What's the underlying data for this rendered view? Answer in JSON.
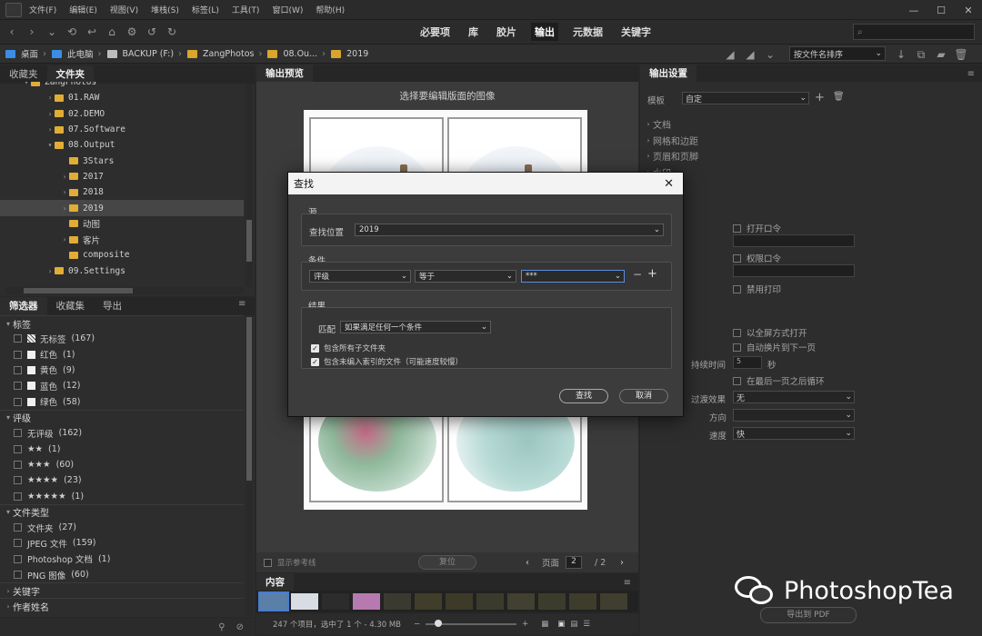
{
  "menu": [
    "文件(F)",
    "编辑(E)",
    "视图(V)",
    "堆栈(S)",
    "标签(L)",
    "工具(T)",
    "窗口(W)",
    "帮助(H)"
  ],
  "workspaces": [
    {
      "label": "必要项"
    },
    {
      "label": "库"
    },
    {
      "label": "胶片"
    },
    {
      "label": "输出",
      "active": true
    },
    {
      "label": "元数据"
    },
    {
      "label": "关键字"
    }
  ],
  "path": [
    "桌面",
    "此电脑",
    "BACKUP (F:)",
    "ZangPhotos",
    "08.Ou...",
    "2019"
  ],
  "sort_label": "按文件名排序",
  "left_tabs": [
    "收藏夹",
    "文件夹"
  ],
  "tree": [
    {
      "label": "ZangPhotos",
      "depth": 1,
      "open": true
    },
    {
      "label": "01.RAW",
      "depth": 2
    },
    {
      "label": "02.DEMO",
      "depth": 2
    },
    {
      "label": "07.Software",
      "depth": 2
    },
    {
      "label": "08.Output",
      "depth": 2,
      "open": true
    },
    {
      "label": "3Stars",
      "depth": 3,
      "nocaret": true
    },
    {
      "label": "2017",
      "depth": 3
    },
    {
      "label": "2018",
      "depth": 3
    },
    {
      "label": "2019",
      "depth": 3,
      "selected": true
    },
    {
      "label": "动图",
      "depth": 3,
      "nocaret": true
    },
    {
      "label": "客片",
      "depth": 3
    },
    {
      "label": "composite",
      "depth": 3,
      "nocaret": true
    },
    {
      "label": "09.Settings",
      "depth": 2
    }
  ],
  "filter_tabs": [
    "筛选器",
    "收藏集",
    "导出"
  ],
  "filters": [
    {
      "heading": "标签",
      "items": [
        {
          "label": "无标签",
          "count": "(167)",
          "swatch": "striped"
        },
        {
          "label": "红色",
          "count": "(1)",
          "swatch": "#f0f0f0"
        },
        {
          "label": "黄色",
          "count": "(9)",
          "swatch": "#f0f0f0"
        },
        {
          "label": "蓝色",
          "count": "(12)",
          "swatch": "#f0f0f0"
        },
        {
          "label": "绿色",
          "count": "(58)",
          "swatch": "#f0f0f0"
        }
      ]
    },
    {
      "heading": "评级",
      "items": [
        {
          "label": "无评级",
          "count": "(162)"
        },
        {
          "label": "★★",
          "count": "(1)"
        },
        {
          "label": "★★★",
          "count": "(60)"
        },
        {
          "label": "★★★★",
          "count": "(23)"
        },
        {
          "label": "★★★★★",
          "count": "(1)"
        }
      ]
    },
    {
      "heading": "文件类型",
      "items": [
        {
          "label": "文件夹",
          "count": "(27)"
        },
        {
          "label": "JPEG 文件",
          "count": "(159)"
        },
        {
          "label": "Photoshop 文档",
          "count": "(1)"
        },
        {
          "label": "PNG 图像",
          "count": "(60)"
        }
      ]
    },
    {
      "heading": "关键字",
      "items": [],
      "collapsed": true
    },
    {
      "heading": "作者姓名",
      "items": [],
      "collapsed": true
    }
  ],
  "center": {
    "tab": "输出预览",
    "hint": "选择要编辑版面的图像",
    "show_guides": "显示参考线",
    "reset": "复位",
    "page_label": "页面",
    "page_value": "2",
    "page_total": "/ 2",
    "content_tab": "内容",
    "status": "247 个项目，选中了 1 个 - 4.30 MB"
  },
  "right": {
    "tab": "输出设置",
    "template_label": "模板",
    "template_value": "自定",
    "sections": [
      "文档",
      "网格和边距",
      "页眉和页脚",
      "水印"
    ],
    "open_pw": "打开口令",
    "perm_pw": "权限口令",
    "no_print": "禁用打印",
    "fullscreen": "以全屏方式打开",
    "auto_advance": "自动换片到下一页",
    "duration_label": "持续时间",
    "duration_value": "5",
    "duration_unit": "秒",
    "loop": "在最后一页之后循环",
    "transition_label": "过渡效果",
    "transition_value": "无",
    "direction_label": "方向",
    "speed_label": "速度",
    "speed_value": "快",
    "export_btn": "导出到 PDF"
  },
  "dialog": {
    "title": "查找",
    "source_group": "源",
    "lookin_label": "查找位置",
    "lookin_value": "2019",
    "criteria_group": "条件",
    "criteria_field": "评级",
    "criteria_op": "等于",
    "criteria_value": "***",
    "results_group": "结果",
    "match_label": "匹配",
    "match_value": "如果满足任何一个条件",
    "include_subfolders": "包含所有子文件夹",
    "include_nonindexed": "包含未编入索引的文件（可能速度较慢）",
    "find_btn": "查找",
    "cancel_btn": "取消"
  },
  "watermark": "PhotoshopTea"
}
